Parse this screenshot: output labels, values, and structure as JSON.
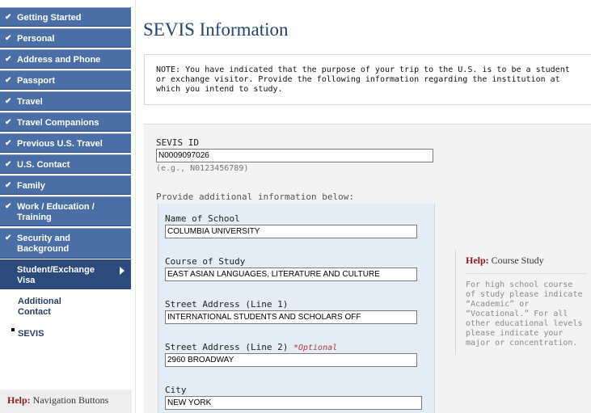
{
  "sidebar": {
    "items": [
      {
        "label": "Getting Started"
      },
      {
        "label": "Personal"
      },
      {
        "label": "Address and Phone"
      },
      {
        "label": "Passport"
      },
      {
        "label": "Travel"
      },
      {
        "label": "Travel Companions"
      },
      {
        "label": "Previous U.S. Travel"
      },
      {
        "label": "U.S. Contact"
      },
      {
        "label": "Family"
      },
      {
        "label": "Work / Education / Training"
      },
      {
        "label": "Security and Background"
      }
    ],
    "active": {
      "label": "Student/Exchange Visa"
    },
    "sub_items": [
      {
        "label": "Additional Contact"
      },
      {
        "label": "SEVIS"
      }
    ],
    "help": {
      "prefix": "Help:",
      "label": "Navigation Buttons"
    }
  },
  "main": {
    "title": "SEVIS Information",
    "note": "NOTE: You have indicated that the purpose of your trip to the U.S. is to be a student or exchange visitor. Provide the following information regarding the institution at which you intend to study.",
    "sevis": {
      "label": "SEVIS ID",
      "value": "N0009097026",
      "hint": "(e.g., N0123456789)"
    },
    "additional_prompt": "Provide additional information below:",
    "school": {
      "name_label": "Name of School",
      "name_value": "COLUMBIA UNIVERSITY",
      "course_label": "Course of Study",
      "course_value": "EAST ASIAN LANGUAGES, LITERATURE AND CULTURE",
      "street1_label": "Street Address (Line 1)",
      "street1_value": "INTERNATIONAL STUDENTS AND SCHOLARS OFF",
      "street2_label": "Street Address (Line 2)",
      "street2_optional": "*Optional",
      "street2_value": "2960 BROADWAY",
      "city_label": "City",
      "city_value": "NEW YORK"
    }
  },
  "help_course": {
    "prefix": "Help:",
    "title": "Course Study",
    "text": "For high school course of study please indicate “Academic” or “Vocational.” For all other educational levels please indicate your major or concentration."
  }
}
